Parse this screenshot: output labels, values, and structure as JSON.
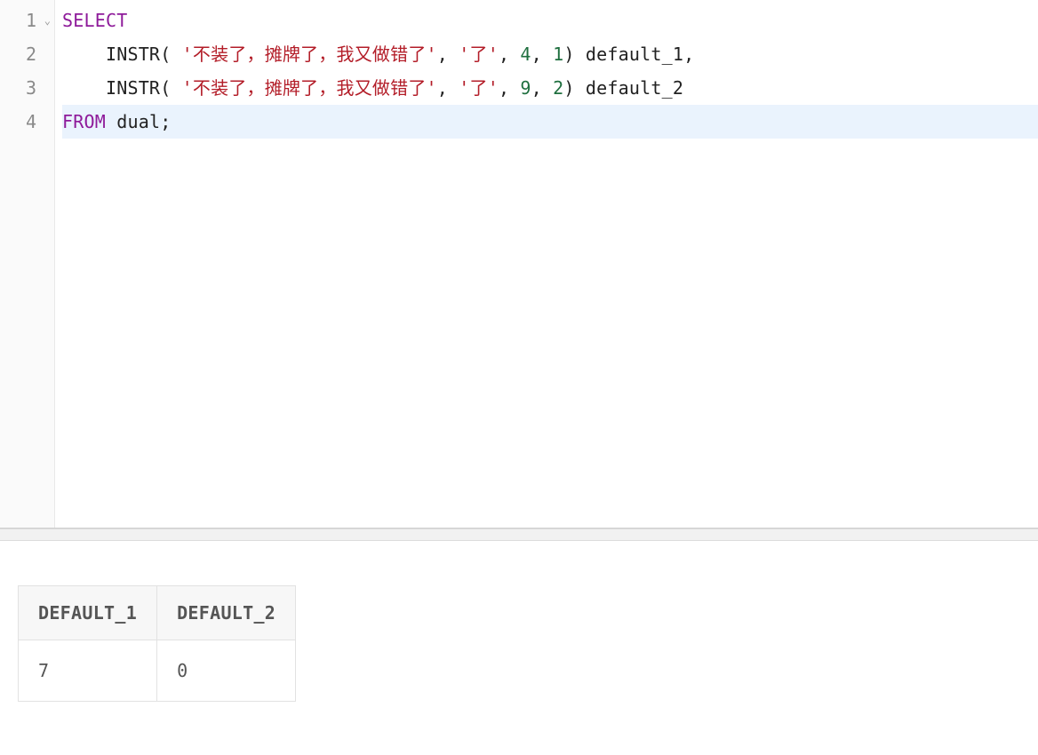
{
  "editor": {
    "lines": [
      {
        "num": "1",
        "foldable": true
      },
      {
        "num": "2",
        "foldable": false
      },
      {
        "num": "3",
        "foldable": false
      },
      {
        "num": "4",
        "foldable": false
      }
    ],
    "code": {
      "line1_kw": "SELECT",
      "line2_indent": "    ",
      "line2_fn": "INSTR",
      "line2_paren_open": "( ",
      "line2_str1": "'不装了，摊牌了，我又做错了'",
      "line2_comma1": ", ",
      "line2_str2": "'了'",
      "line2_comma2": ", ",
      "line2_num1": "4",
      "line2_comma3": ", ",
      "line2_num2": "1",
      "line2_paren_close": ") ",
      "line2_alias": "default_1",
      "line2_trailing": ",",
      "line3_indent": "    ",
      "line3_fn": "INSTR",
      "line3_paren_open": "( ",
      "line3_str1": "'不装了，摊牌了，我又做错了'",
      "line3_comma1": ", ",
      "line3_str2": "'了'",
      "line3_comma2": ", ",
      "line3_num1": "9",
      "line3_comma3": ", ",
      "line3_num2": "2",
      "line3_paren_close": ") ",
      "line3_alias": "default_2",
      "line4_kw": "FROM",
      "line4_sp": " ",
      "line4_tbl": "dual",
      "line4_semi": ";"
    }
  },
  "results": {
    "columns": [
      "DEFAULT_1",
      "DEFAULT_2"
    ],
    "rows": [
      [
        "7",
        "0"
      ]
    ]
  }
}
